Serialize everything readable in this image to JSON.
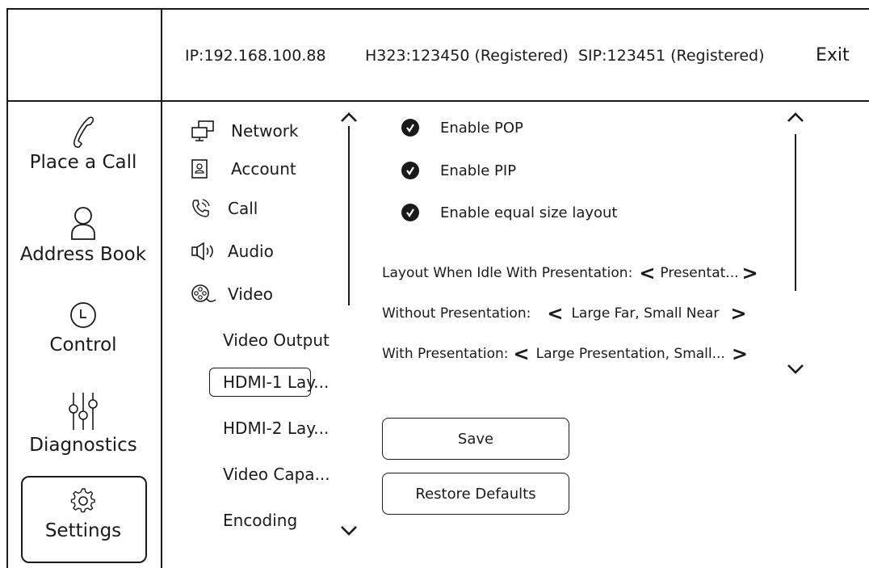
{
  "header": {
    "ip": "IP:192.168.100.88",
    "h323": "H323:123450 (Registered)",
    "sip": "SIP:123451 (Registered)",
    "exit_label": "Exit"
  },
  "nav": {
    "items": [
      {
        "label": "Place a Call",
        "icon": "phone-icon"
      },
      {
        "label": "Address Book",
        "icon": "person-icon"
      },
      {
        "label": "Control",
        "icon": "clock-icon"
      },
      {
        "label": "Diagnostics",
        "icon": "sliders-icon"
      },
      {
        "label": "Settings",
        "icon": "gear-icon",
        "selected": true
      }
    ]
  },
  "settings_menu": {
    "items": [
      {
        "label": "Network",
        "icon": "network-icon"
      },
      {
        "label": "Account",
        "icon": "account-icon"
      },
      {
        "label": "Call",
        "icon": "call-icon"
      },
      {
        "label": "Audio",
        "icon": "audio-icon"
      },
      {
        "label": "Video",
        "icon": "video-icon"
      }
    ],
    "video_subitems": [
      {
        "label": "Video Output"
      },
      {
        "label": "HDMI-1 Lay...",
        "selected": true
      },
      {
        "label": "HDMI-2 Lay..."
      },
      {
        "label": "Video Capa..."
      },
      {
        "label": "Encoding"
      }
    ]
  },
  "content": {
    "checkboxes": [
      {
        "label": "Enable POP",
        "checked": true
      },
      {
        "label": "Enable PIP",
        "checked": true
      },
      {
        "label": "Enable equal size layout",
        "checked": true
      }
    ],
    "layouts": [
      {
        "label": "Layout When Idle With Presentation:",
        "value": "Presentat..."
      },
      {
        "label": "Without Presentation:",
        "value": "Large Far, Small Near"
      },
      {
        "label": "With Presentation:",
        "value": "Large Presentation, Small..."
      }
    ],
    "save_label": "Save",
    "restore_label": "Restore Defaults"
  }
}
